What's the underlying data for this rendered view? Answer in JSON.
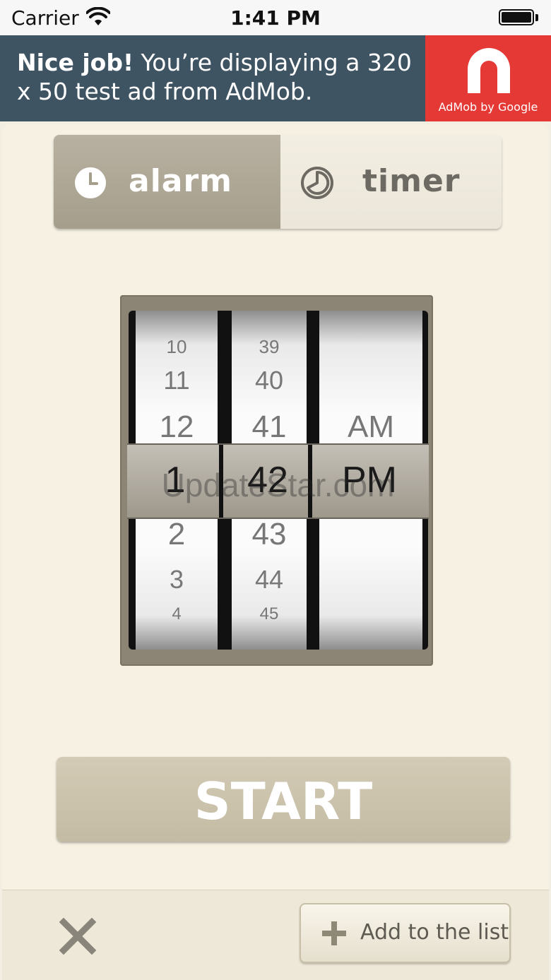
{
  "status_bar": {
    "carrier": "Carrier",
    "time": "1:41 PM",
    "wifi_icon": "wifi-icon",
    "battery_icon": "battery-icon"
  },
  "ad": {
    "bold": "Nice job!",
    "text": " You’re displaying a 320 x 50 test ad from AdMob.",
    "logo_text": "AdMob by Google",
    "logo_icon": "admob-logo-icon",
    "colors": {
      "background": "#3f5463",
      "logo_background": "#e53935"
    }
  },
  "mode_tabs": {
    "alarm": {
      "label": "alarm",
      "icon": "clock-icon",
      "selected": true
    },
    "timer": {
      "label": "timer",
      "icon": "timer-icon",
      "selected": false
    }
  },
  "picker": {
    "hours": [
      "10",
      "11",
      "12",
      "1",
      "2",
      "3",
      "4"
    ],
    "minutes": [
      "39",
      "40",
      "41",
      "42",
      "43",
      "44",
      "45"
    ],
    "meridiem": [
      "AM",
      "PM"
    ],
    "selected": {
      "hour": "1",
      "minute": "42",
      "meridiem": "PM"
    },
    "watermark": "UpdateStar.com"
  },
  "start_button": {
    "label": "START"
  },
  "toolbar": {
    "close_icon": "close-icon",
    "add_label": "Add to the list",
    "add_icon": "plus-icon"
  },
  "colors": {
    "panel": "#f6f1e3",
    "accent": "#a59e8c",
    "start": "#c9c1a9"
  }
}
